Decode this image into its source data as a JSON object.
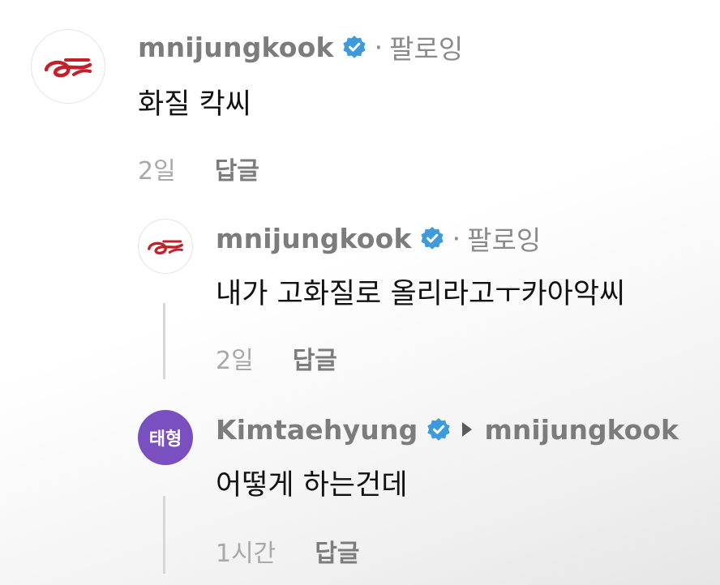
{
  "comments": [
    {
      "username": "mnijungkook",
      "verified": true,
      "follow_status": "팔로잉",
      "text": "화질 칵씨",
      "time": "2일",
      "reply_label": "답글",
      "avatar": "logo-avatar"
    },
    {
      "username": "mnijungkook",
      "verified": true,
      "follow_status": "팔로잉",
      "text": "내가 고화질로 올리라고ㅜ카아악씨",
      "time": "2일",
      "reply_label": "답글",
      "avatar": "logo-avatar"
    },
    {
      "username": "Kimtaehyung",
      "verified": true,
      "reply_to": "mnijungkook",
      "avatar_text": "태형",
      "text": "어떻게 하는건데",
      "time": "1시간",
      "reply_label": "답글"
    }
  ],
  "colors": {
    "verified_badge": "#3d9bdc",
    "logo_red": "#c4202a",
    "avatar_purple": "#7a4fc0"
  },
  "icons": {
    "verified": "verified-badge-icon",
    "reply_arrow": "caret-right-icon",
    "logo": "brand-logo-icon"
  }
}
